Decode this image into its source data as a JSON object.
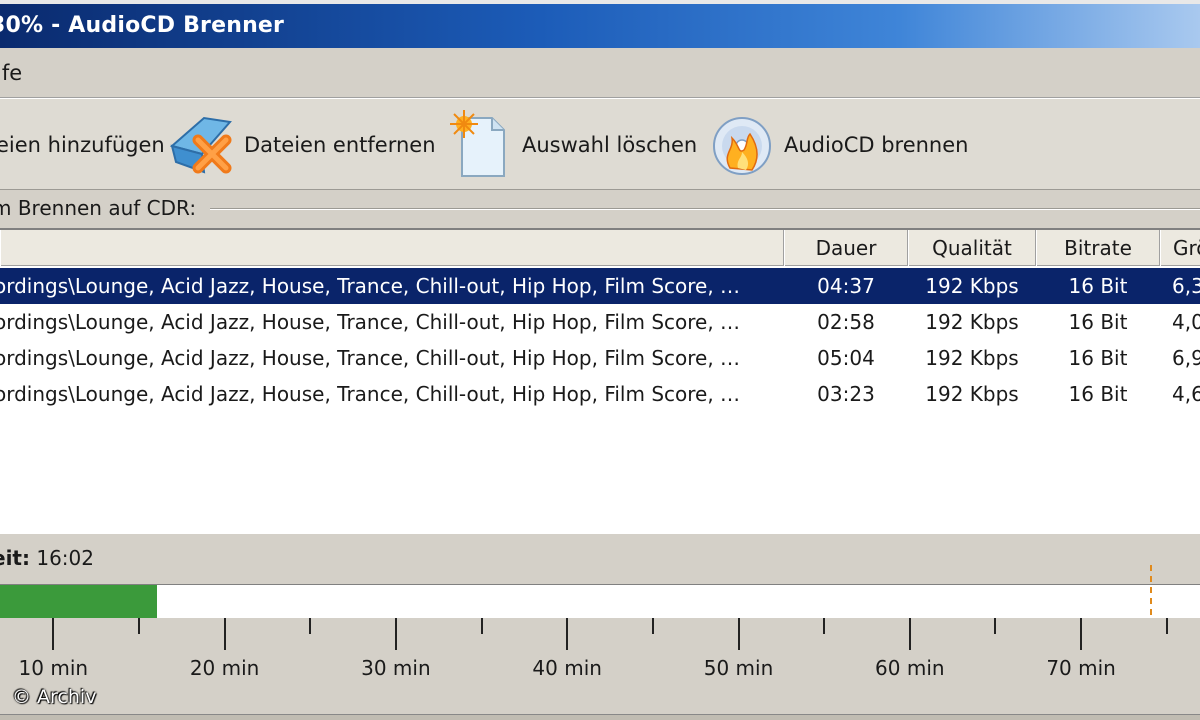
{
  "window": {
    "title": "30% - AudioCD Brenner"
  },
  "menu": {
    "items": [
      "lfe"
    ]
  },
  "toolbar": {
    "buttons": [
      {
        "label": "eien hinzufügen",
        "icon": "add-files-icon"
      },
      {
        "label": "Dateien entfernen",
        "icon": "remove-files-icon"
      },
      {
        "label": "Auswahl löschen",
        "icon": "clear-selection-icon"
      },
      {
        "label": "AudioCD brennen",
        "icon": "burn-cd-icon"
      }
    ]
  },
  "section": {
    "label": "m Brennen auf CDR:"
  },
  "list": {
    "columns": [
      "",
      "Dauer",
      "Qualität",
      "Bitrate",
      "Grö"
    ],
    "rows": [
      {
        "path": "ordings\\Lounge, Acid Jazz, House, Trance, Chill-out, Hip Hop, Film Score, …",
        "duration": "04:37",
        "quality": "192 Kbps",
        "bitrate": "16 Bit",
        "size": "6,3",
        "selected": true
      },
      {
        "path": "ordings\\Lounge, Acid Jazz, House, Trance, Chill-out, Hip Hop, Film Score, …",
        "duration": "02:58",
        "quality": "192 Kbps",
        "bitrate": "16 Bit",
        "size": "4,0",
        "selected": false
      },
      {
        "path": "ordings\\Lounge, Acid Jazz, House, Trance, Chill-out, Hip Hop, Film Score, …",
        "duration": "05:04",
        "quality": "192 Kbps",
        "bitrate": "16 Bit",
        "size": "6,9",
        "selected": false
      },
      {
        "path": "ordings\\Lounge, Acid Jazz, House, Trance, Chill-out, Hip Hop, Film Score, …",
        "duration": "03:23",
        "quality": "192 Kbps",
        "bitrate": "16 Bit",
        "size": "4,6",
        "selected": false
      }
    ]
  },
  "total_time": {
    "label": "eit:",
    "value": "16:02"
  },
  "timeline": {
    "fill_minutes": 16.03,
    "limit_minutes": 74,
    "tick_labels": [
      "10 min",
      "20 min",
      "30 min",
      "40 min",
      "50 min",
      "60 min",
      "70 min"
    ],
    "fill_color": "#3b9a3b",
    "limit_color": "#e08a1c"
  },
  "watermark": {
    "text": "© Archiv"
  },
  "colors": {
    "selection": "#0a246a",
    "titlebar": "#1c5cb8"
  }
}
